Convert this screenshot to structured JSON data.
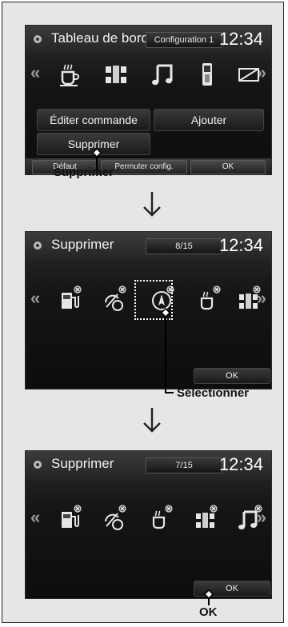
{
  "screen1": {
    "title": "Tableau de bord",
    "config_label": "Configuration 1",
    "clock": "12:34",
    "icons": [
      "coffee-icon",
      "chassis-icon",
      "music-note-icon",
      "phone-icon",
      "envelope-icon"
    ],
    "buttons": {
      "edit": "Éditer commande",
      "add": "Ajouter",
      "delete": "Supprimer"
    },
    "bottom": {
      "default": "Défaut",
      "swap": "Permuter config.",
      "ok": "OK"
    }
  },
  "callout1": "Supprimer",
  "screen2": {
    "title": "Supprimer",
    "page": "8/15",
    "clock": "12:34",
    "icons": [
      "fuel-icon",
      "trip-icon",
      "compass-icon",
      "coffee-icon",
      "chassis-icon"
    ],
    "ok": "OK"
  },
  "callout2": "Sélectionner",
  "screen3": {
    "title": "Supprimer",
    "page": "7/15",
    "clock": "12:34",
    "icons": [
      "fuel-icon",
      "trip-icon",
      "coffee-icon",
      "chassis-icon",
      "music-note-icon"
    ],
    "ok": "OK"
  },
  "callout3": "OK"
}
